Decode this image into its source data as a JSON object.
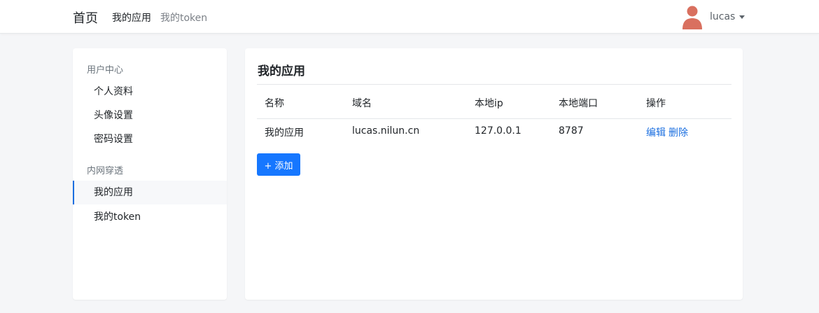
{
  "nav": {
    "brand": "首页",
    "links": [
      "我的应用",
      "我的token"
    ],
    "user": {
      "name": "lucas",
      "icon": "user-avatar-icon",
      "caret_icon": "caret-down-icon"
    }
  },
  "sidebar": {
    "sections": [
      {
        "heading": "用户中心",
        "items": [
          "个人资料",
          "头像设置",
          "密码设置"
        ]
      },
      {
        "heading": "内网穿透",
        "items": [
          "我的应用",
          "我的token"
        ]
      }
    ],
    "active_item": "我的应用"
  },
  "main": {
    "title": "我的应用",
    "table": {
      "headers": [
        "名称",
        "域名",
        "本地ip",
        "本地端口",
        "操作"
      ],
      "rows": [
        {
          "name": "我的应用",
          "domain": "lucas.nilun.cn",
          "ip": "127.0.0.1",
          "port": "8787",
          "actions": [
            "编辑",
            "删除"
          ]
        }
      ]
    },
    "add_button": "+ 添加"
  },
  "colors": {
    "accent": "#1677ff",
    "link": "#1b6fe0",
    "background": "#f5f6f8",
    "avatar": "#d9705f"
  }
}
